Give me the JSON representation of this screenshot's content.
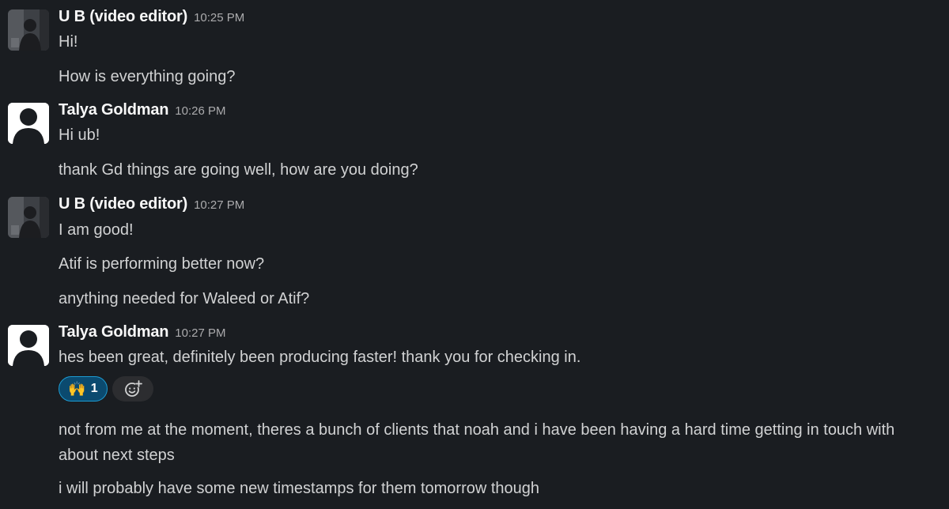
{
  "messages": [
    {
      "sender": "U B (video editor)",
      "time": "10:25 PM",
      "avatar": "photo-avatar",
      "lines": [
        "Hi!",
        "How is everything going?"
      ]
    },
    {
      "sender": "Talya Goldman",
      "time": "10:26 PM",
      "avatar": "default-user-avatar",
      "lines": [
        "Hi ub!",
        "thank Gd things are going well, how are you doing?"
      ]
    },
    {
      "sender": "U B (video editor)",
      "time": "10:27 PM",
      "avatar": "photo-avatar",
      "lines": [
        "I am good!",
        "Atif is performing better now?",
        "anything needed for Waleed or Atif?"
      ]
    },
    {
      "sender": "Talya Goldman",
      "time": "10:27 PM",
      "avatar": "default-user-avatar",
      "lines": [
        "hes been great, definitely been producing faster! thank you for checking in.",
        "not from me at the moment, theres a bunch of clients that noah and i have been having a hard time getting in touch with about next steps",
        "i will probably have some new timestamps for them tomorrow though"
      ],
      "reaction": {
        "emoji": "🙌",
        "icon": "raised-hands-emoji",
        "count": "1",
        "add_icon": "add-reaction-icon"
      }
    }
  ],
  "colors": {
    "background": "#1a1d21",
    "text": "#d1d2d3",
    "sender": "#f8f8f8",
    "timestamp": "#ababad",
    "reaction_bg": "#0b4a6f",
    "reaction_border": "#1d9bd1"
  }
}
